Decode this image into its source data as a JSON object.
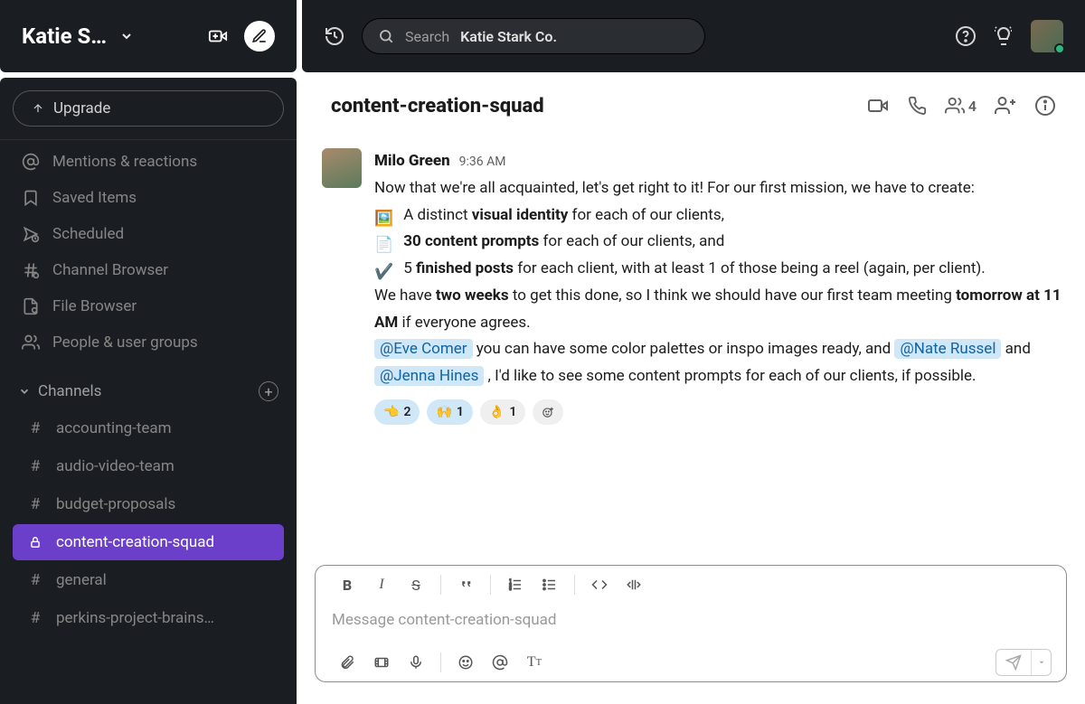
{
  "workspace": {
    "name": "Katie S…",
    "full_name": "Katie Stark Co."
  },
  "sidebar": {
    "upgrade": "Upgrade",
    "nav": [
      {
        "icon": "at-icon",
        "label": "Mentions & reactions"
      },
      {
        "icon": "bookmark-icon",
        "label": "Saved Items"
      },
      {
        "icon": "scheduled-icon",
        "label": "Scheduled"
      },
      {
        "icon": "channel-browser-icon",
        "label": "Channel Browser"
      },
      {
        "icon": "file-browser-icon",
        "label": "File Browser"
      },
      {
        "icon": "people-icon",
        "label": "People & user groups"
      }
    ],
    "channels_label": "Channels",
    "channels": [
      {
        "name": "accounting-team",
        "locked": false,
        "active": false
      },
      {
        "name": "audio-video-team",
        "locked": false,
        "active": false
      },
      {
        "name": "budget-proposals",
        "locked": false,
        "active": false
      },
      {
        "name": "content-creation-squad",
        "locked": true,
        "active": true
      },
      {
        "name": "general",
        "locked": false,
        "active": false
      },
      {
        "name": "perkins-project-brains…",
        "locked": false,
        "active": false
      }
    ]
  },
  "search": {
    "prefix": "Search",
    "workspace": "Katie Stark Co."
  },
  "channel": {
    "title": "content-creation-squad",
    "member_count": "4"
  },
  "message": {
    "author": "Milo Green",
    "time": "9:36 AM",
    "line_intro": "Now that we're all acquainted, let's get right to it! For our first mission, we have to create:",
    "bullet1_pre": " A distinct ",
    "bullet1_bold": "visual identity",
    "bullet1_post": " for each of our clients,",
    "bullet2_pre": " ",
    "bullet2_bold": "30 content prompts",
    "bullet2_post": " for each of our clients, and",
    "bullet3_pre": " 5 ",
    "bullet3_bold": "finished posts",
    "bullet3_post": " for each client, with at least 1 of those being a reel (again, per client).",
    "line4_pre": "We have ",
    "line4_bold": "two weeks",
    "line4_mid": " to get this done, so I think we should have our first team meeting ",
    "line4_bold2": "tomorrow at 11 AM",
    "line4_post": " if everyone agrees.",
    "m1": "@Eve Comer",
    "after_m1": "  you can have some color palettes or inspo images ready, and ",
    "m2": "@Nate Russel",
    "between_m2_m3": "  and  ",
    "m3": "@Jenna Hines",
    "after_m3": " , I'd like to see some content prompts for each of our clients, if possible.",
    "reactions": [
      {
        "emoji": "👈",
        "count": "2",
        "selected": true
      },
      {
        "emoji": "🙌",
        "count": "1",
        "selected": true
      },
      {
        "emoji": "👌",
        "count": "1",
        "selected": false
      }
    ]
  },
  "composer": {
    "placeholder": "Message content-creation-squad"
  }
}
